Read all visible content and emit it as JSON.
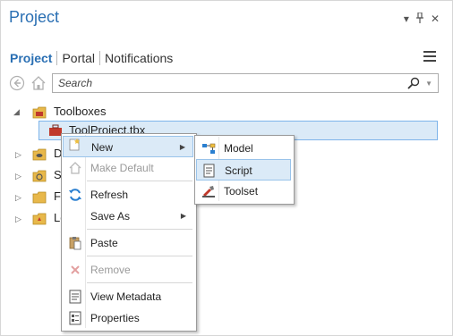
{
  "pane": {
    "title": "Project",
    "controls": [
      "dropdown-icon",
      "pin-icon",
      "close-icon"
    ],
    "controls_glyphs": [
      "▾",
      "ᵽ",
      "✕"
    ]
  },
  "tabs": [
    {
      "label": "Project",
      "active": true
    },
    {
      "label": "Portal",
      "active": false
    },
    {
      "label": "Notifications",
      "active": false
    }
  ],
  "search": {
    "placeholder": "Search"
  },
  "tree": {
    "toolboxes_label": "Toolboxes",
    "selected_item": "ToolProject.tbx",
    "partial_labels": [
      "D",
      "St",
      "Fo",
      "Lo"
    ]
  },
  "context_menu": {
    "items": [
      {
        "label": "New",
        "icon": "new-icon",
        "submenu": true,
        "enabled": true,
        "highlighted": true
      },
      {
        "label": "Make Default",
        "icon": "home-icon",
        "submenu": false,
        "enabled": false
      },
      {
        "label": "Refresh",
        "icon": "refresh-icon",
        "submenu": false,
        "enabled": true
      },
      {
        "label": "Save As",
        "icon": "",
        "submenu": true,
        "enabled": true
      },
      {
        "label": "Paste",
        "icon": "paste-icon",
        "submenu": false,
        "enabled": true
      },
      {
        "label": "Remove",
        "icon": "remove-icon",
        "submenu": false,
        "enabled": false
      },
      {
        "label": "View Metadata",
        "icon": "metadata-icon",
        "submenu": false,
        "enabled": true
      },
      {
        "label": "Properties",
        "icon": "properties-icon",
        "submenu": false,
        "enabled": true
      }
    ]
  },
  "submenu": {
    "items": [
      {
        "label": "Model",
        "icon": "model-icon",
        "highlighted": false
      },
      {
        "label": "Script",
        "icon": "script-icon",
        "highlighted": true
      },
      {
        "label": "Toolset",
        "icon": "toolset-icon",
        "highlighted": false
      }
    ]
  },
  "colors": {
    "accent": "#2a6fb3",
    "selection": "#dbeaf7",
    "selection_border": "#7eb4ea"
  }
}
